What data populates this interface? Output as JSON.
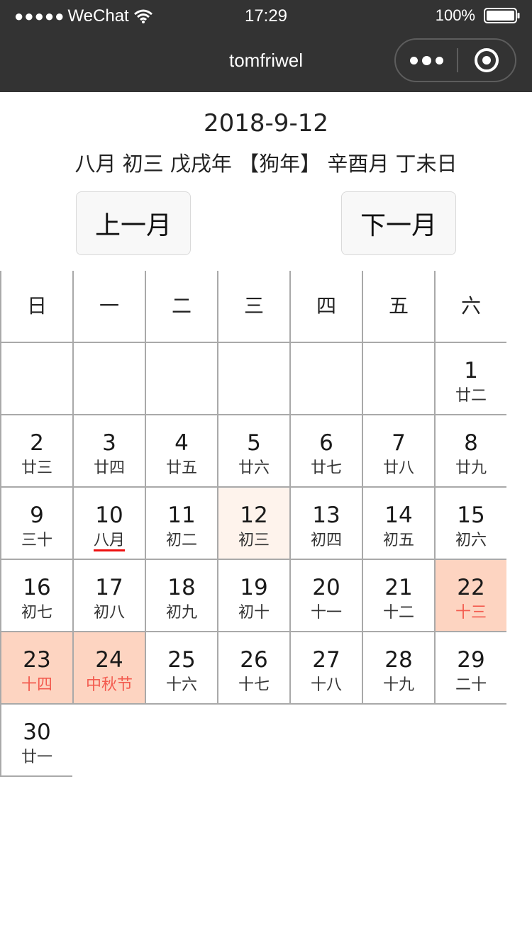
{
  "status_bar": {
    "signal": "●●●●●",
    "carrier": "WeChat",
    "time": "17:29",
    "battery_percent": "100%",
    "battery_level": 1.0
  },
  "nav": {
    "title": "tomfriwel"
  },
  "header": {
    "date": "2018-9-12",
    "lunar_info": "八月 初三 戊戌年 【狗年】 辛酉月 丁未日"
  },
  "buttons": {
    "prev_month": "上一月",
    "next_month": "下一月"
  },
  "weekdays": [
    "日",
    "一",
    "二",
    "三",
    "四",
    "五",
    "六"
  ],
  "colors": {
    "today_bg": "#fef3ec",
    "holiday_bg": "#fdd4c1",
    "holiday_text": "#f35b4f",
    "underline": "#ee1111",
    "bar_bg": "#333333"
  },
  "days": [
    {
      "solar": "1",
      "lunar": "廿二"
    },
    {
      "solar": "2",
      "lunar": "廿三"
    },
    {
      "solar": "3",
      "lunar": "廿四"
    },
    {
      "solar": "4",
      "lunar": "廿五"
    },
    {
      "solar": "5",
      "lunar": "廿六"
    },
    {
      "solar": "6",
      "lunar": "廿七"
    },
    {
      "solar": "7",
      "lunar": "廿八"
    },
    {
      "solar": "8",
      "lunar": "廿九"
    },
    {
      "solar": "9",
      "lunar": "三十"
    },
    {
      "solar": "10",
      "lunar": "八月",
      "month_start": true
    },
    {
      "solar": "11",
      "lunar": "初二"
    },
    {
      "solar": "12",
      "lunar": "初三",
      "today": true
    },
    {
      "solar": "13",
      "lunar": "初四"
    },
    {
      "solar": "14",
      "lunar": "初五"
    },
    {
      "solar": "15",
      "lunar": "初六"
    },
    {
      "solar": "16",
      "lunar": "初七"
    },
    {
      "solar": "17",
      "lunar": "初八"
    },
    {
      "solar": "18",
      "lunar": "初九"
    },
    {
      "solar": "19",
      "lunar": "初十"
    },
    {
      "solar": "20",
      "lunar": "十一"
    },
    {
      "solar": "21",
      "lunar": "十二"
    },
    {
      "solar": "22",
      "lunar": "十三",
      "holiday": true
    },
    {
      "solar": "23",
      "lunar": "十四",
      "holiday": true
    },
    {
      "solar": "24",
      "lunar": "中秋节",
      "holiday": true
    },
    {
      "solar": "25",
      "lunar": "十六"
    },
    {
      "solar": "26",
      "lunar": "十七"
    },
    {
      "solar": "27",
      "lunar": "十八"
    },
    {
      "solar": "28",
      "lunar": "十九"
    },
    {
      "solar": "29",
      "lunar": "二十"
    },
    {
      "solar": "30",
      "lunar": "廿一"
    }
  ],
  "first_weekday": 6
}
